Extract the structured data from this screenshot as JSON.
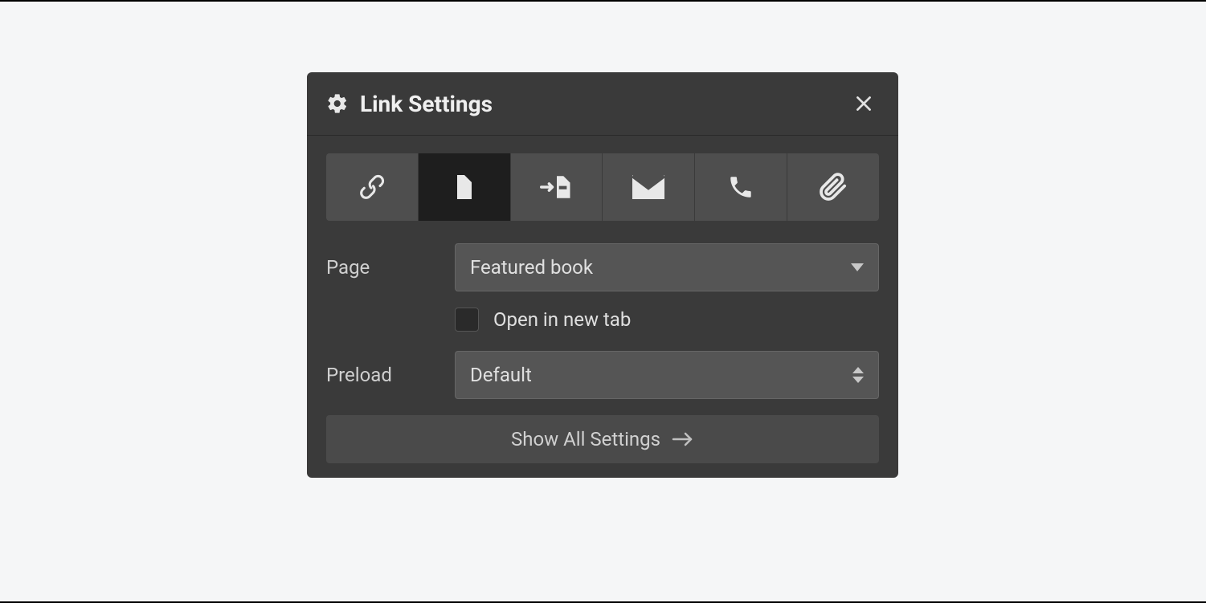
{
  "panel": {
    "title": "Link Settings",
    "tabs": [
      {
        "name": "url",
        "icon": "link-icon",
        "active": false
      },
      {
        "name": "page",
        "icon": "page-icon",
        "active": true
      },
      {
        "name": "page-section",
        "icon": "page-section-icon",
        "active": false
      },
      {
        "name": "email",
        "icon": "mail-icon",
        "active": false
      },
      {
        "name": "phone",
        "icon": "phone-icon",
        "active": false
      },
      {
        "name": "file",
        "icon": "attachment-icon",
        "active": false
      }
    ],
    "fields": {
      "page": {
        "label": "Page",
        "value": "Featured book"
      },
      "open_new_tab": {
        "label": "Open in new tab",
        "checked": false
      },
      "preload": {
        "label": "Preload",
        "value": "Default"
      }
    },
    "footer": {
      "show_all_label": "Show All Settings"
    }
  }
}
